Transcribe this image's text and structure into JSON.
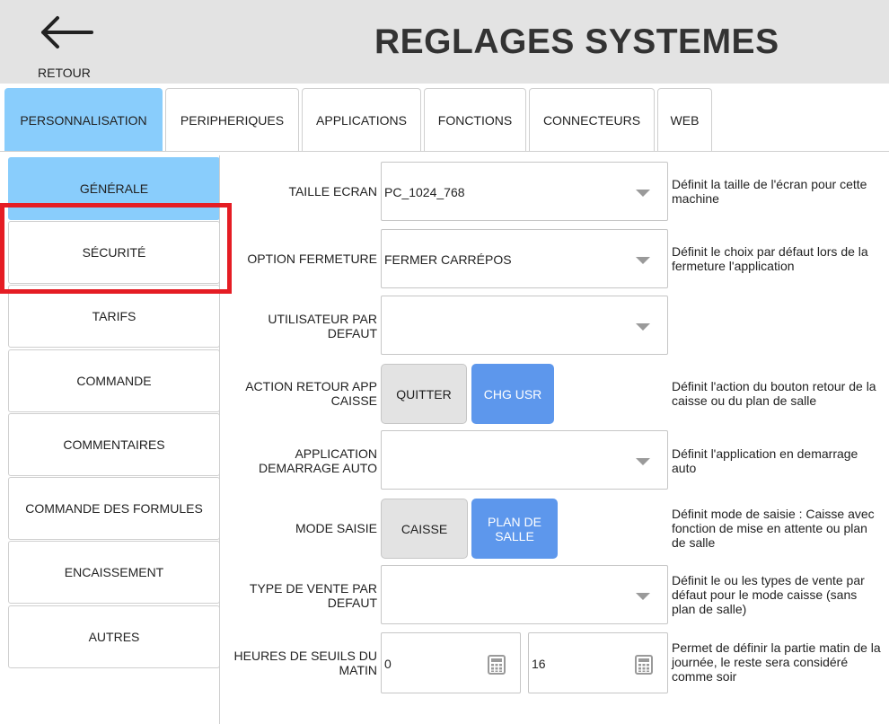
{
  "header": {
    "back_label": "RETOUR",
    "title": "REGLAGES SYSTEMES",
    "icons": {
      "back": "arrow-left-icon"
    }
  },
  "tabs": [
    {
      "label": "PERSONNALISATION",
      "active": true
    },
    {
      "label": "PERIPHERIQUES"
    },
    {
      "label": "APPLICATIONS"
    },
    {
      "label": "FONCTIONS"
    },
    {
      "label": "CONNECTEURS"
    },
    {
      "label": "WEB"
    }
  ],
  "sidebar": {
    "items": [
      {
        "label": "GÉNÉRALE",
        "active": true
      },
      {
        "label": "SÉCURITÉ",
        "highlighted": true
      },
      {
        "label": "TARIFS"
      },
      {
        "label": "COMMANDE"
      },
      {
        "label": "COMMENTAIRES"
      },
      {
        "label": "COMMANDE DES FORMULES"
      },
      {
        "label": "ENCAISSEMENT"
      },
      {
        "label": "AUTRES"
      }
    ]
  },
  "form": {
    "taille_ecran": {
      "label": "TAILLE ECRAN",
      "value": "PC_1024_768",
      "desc": "Définit la taille de l'écran pour cette machine"
    },
    "option_fermeture": {
      "label": "OPTION FERMETURE",
      "value": "FERMER CARRÉPOS",
      "desc": "Définit le choix par défaut lors de la fermeture l'application"
    },
    "utilisateur_defaut": {
      "label": "UTILISATEUR PAR DEFAUT",
      "value": "",
      "desc": ""
    },
    "action_retour": {
      "label": "ACTION RETOUR APP CAISSE",
      "option_quitter": "QUITTER",
      "option_chg_usr": "CHG USR",
      "selected": "CHG USR",
      "desc": "Définit l'action du bouton retour de la caisse ou du plan de salle"
    },
    "application_demarrage": {
      "label": "APPLICATION DEMARRAGE AUTO",
      "value": "",
      "desc": "Définit l'application en demarrage auto"
    },
    "mode_saisie": {
      "label": "MODE SAISIE",
      "option_caisse": "CAISSE",
      "option_plan": "PLAN DE SALLE",
      "selected": "PLAN DE SALLE",
      "desc": "Définit mode de saisie : Caisse avec fonction de mise en attente ou plan de salle"
    },
    "type_vente": {
      "label": "TYPE DE VENTE PAR DEFAUT",
      "value": "",
      "desc": "Définit le ou les types de vente par défaut pour le mode caisse (sans plan de salle)"
    },
    "heures_seuils": {
      "label": "HEURES DE SEUILS DU MATIN",
      "value_start": "0",
      "value_end": "16",
      "desc": "Permet de définir la partie matin de la journée, le reste sera considéré comme soir"
    }
  },
  "colors": {
    "active_tab": "#89cdfc",
    "toggle_on": "#5d97ec",
    "highlight": "#e51d24",
    "header_bg": "#e3e3e3"
  }
}
